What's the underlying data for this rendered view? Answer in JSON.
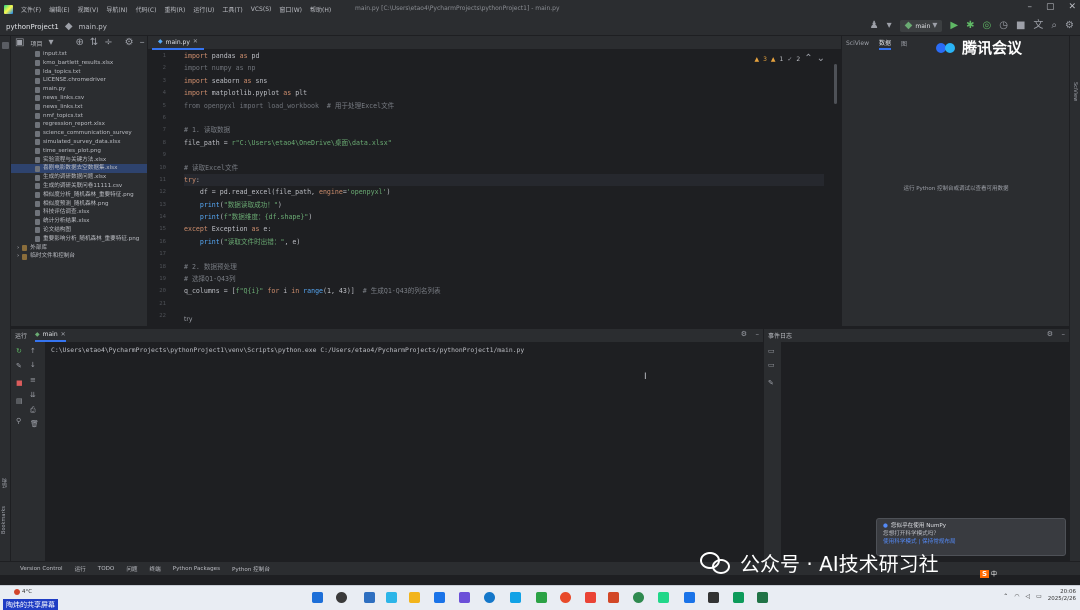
{
  "menubar": {
    "items": [
      "文件(F)",
      "编辑(E)",
      "视图(V)",
      "导航(N)",
      "代码(C)",
      "重构(R)",
      "运行(U)",
      "工具(T)",
      "VCS(S)",
      "窗口(W)",
      "帮助(H)"
    ],
    "window_title": "main.py [C:\\Users\\etao4\\PycharmProjects\\pythonProject1] - main.py"
  },
  "navbar": {
    "project": "pythonProject1",
    "file": "main.py",
    "run_config": "main"
  },
  "project_panel": {
    "title": "项目",
    "files": [
      "input.txt",
      "kmo_bartlett_results.xlsx",
      "lda_topics.txt",
      "LICENSE.chromedriver",
      "main.py",
      "news_links.csv",
      "news_links.txt",
      "nmf_topics.txt",
      "regression_report.xlsx",
      "science_communication_survey",
      "simulated_survey_data.xlsx",
      "time_series_plot.png",
      "实验流程与关键方法.xlsx",
      "喜剧电影数据去空数据集.xlsx",
      "生成的调研数据问题.xlsx",
      "生成的调研关联问卷11111.csv",
      "相似度分析_随机森林_重要特征.png",
      "相似度预测_随机森林.png",
      "科技评估调查.xlsx",
      "统计分析结果.xlsx",
      "论文结构图",
      "重要影响分析_随机森林_重要特征.png"
    ],
    "selected_index": 13,
    "groups": [
      "外部库",
      "临时文件和控制台"
    ]
  },
  "editor": {
    "tab": "main.py",
    "inspection": {
      "warnings": "3",
      "weak": "1",
      "typos": "2"
    },
    "lines": [
      [
        [
          "kw",
          "import "
        ],
        [
          "txt",
          "pandas "
        ],
        [
          "kw",
          "as "
        ],
        [
          "txt",
          "pd"
        ]
      ],
      [
        [
          "dim",
          "import numpy as np"
        ]
      ],
      [
        [
          "kw",
          "import "
        ],
        [
          "txt",
          "seaborn "
        ],
        [
          "kw",
          "as "
        ],
        [
          "txt",
          "sns"
        ]
      ],
      [
        [
          "kw",
          "import "
        ],
        [
          "txt",
          "matplotlib.pyplot "
        ],
        [
          "kw",
          "as "
        ],
        [
          "txt",
          "plt"
        ]
      ],
      [
        [
          "dim",
          "from openpyxl import load_workbook  "
        ],
        [
          "cm",
          "# 用于处理Excel文件"
        ]
      ],
      [],
      [
        [
          "cm",
          "# 1. 读取数据"
        ]
      ],
      [
        [
          "txt",
          "file_path = "
        ],
        [
          "st",
          "r\"C:\\Users\\etao4\\OneDrive\\桌面\\data.xlsx\""
        ]
      ],
      [],
      [
        [
          "cm",
          "# 读取Excel文件"
        ]
      ],
      [
        [
          "kw",
          "try"
        ],
        [
          "txt",
          ":"
        ]
      ],
      [
        [
          "txt",
          "    df = pd.read_excel(file_path, "
        ],
        [
          "kw",
          "engine"
        ],
        [
          "txt",
          "="
        ],
        [
          "st",
          "'openpyxl'"
        ],
        [
          "txt",
          ")"
        ]
      ],
      [
        [
          "txt",
          "    "
        ],
        [
          "fn",
          "print"
        ],
        [
          "txt",
          "("
        ],
        [
          "st",
          "\"数据读取成功！\""
        ],
        [
          "txt",
          ")"
        ]
      ],
      [
        [
          "txt",
          "    "
        ],
        [
          "fn",
          "print"
        ],
        [
          "txt",
          "("
        ],
        [
          "st",
          "f\"数据维度：{df.shape}\""
        ],
        [
          "txt",
          ")"
        ]
      ],
      [
        [
          "kw",
          "except "
        ],
        [
          "txt",
          "Exception "
        ],
        [
          "kw",
          "as "
        ],
        [
          "txt",
          "e:"
        ]
      ],
      [
        [
          "txt",
          "    "
        ],
        [
          "fn",
          "print"
        ],
        [
          "txt",
          "("
        ],
        [
          "st",
          "\"读取文件时出错：\""
        ],
        [
          "txt",
          ", e)"
        ]
      ],
      [],
      [
        [
          "cm",
          "# 2. 数据预处理"
        ]
      ],
      [
        [
          "cm",
          "# 选择Q1-Q43列"
        ]
      ],
      [
        [
          "txt",
          "q_columns = ["
        ],
        [
          "st",
          "f\"Q{i}\""
        ],
        [
          "txt",
          " "
        ],
        [
          "kw",
          "for "
        ],
        [
          "txt",
          "i "
        ],
        [
          "kw",
          "in "
        ],
        [
          "fn",
          "range"
        ],
        [
          "txt",
          "(1, 43)]  "
        ],
        [
          "cm",
          "# 生成Q1-Q43的列名列表"
        ]
      ],
      [],
      []
    ],
    "current_line": 11,
    "breadcrumb": "try"
  },
  "sciview": {
    "title": "SciView",
    "tabs": [
      "数据",
      "图"
    ],
    "message": "运行 Python 控制台或调试以查看可用数据"
  },
  "run_panel": {
    "label": "运行",
    "tab": "main",
    "command": "C:\\Users\\etao4\\PycharmProjects\\pythonProject1\\venv\\Scripts\\python.exe C:/Users/etao4/PycharmProjects/pythonProject1/main.py"
  },
  "event_log": {
    "title": "事件日志"
  },
  "notification": {
    "title": "您似乎在使用 NumPy",
    "body": "您想打开科学模式吗？",
    "link": "使用科学模式 | 保持常规布局"
  },
  "statusbar": {
    "items": [
      "Version Control",
      "运行",
      "TODO",
      "问题",
      "终端",
      "Python Packages",
      "Python 控制台"
    ]
  },
  "watermarks": {
    "tencent_meeting": "腾讯会议",
    "wechat": "公众号 · AI技术研习社"
  },
  "taskbar": {
    "weather": "4°C",
    "sharing": "陶炜的共享屏幕",
    "time": "20:06",
    "date": "2025/2/26"
  },
  "sidebar_labels": {
    "bookmarks": "Bookmarks",
    "structure": "结构",
    "sciview": "SciView"
  },
  "colors": {
    "bg": "#1e1f22",
    "panel": "#2b2d30",
    "accent": "#3574f0",
    "keyword": "#cf8e6d",
    "string": "#6aab73",
    "comment": "#7a7e85"
  }
}
